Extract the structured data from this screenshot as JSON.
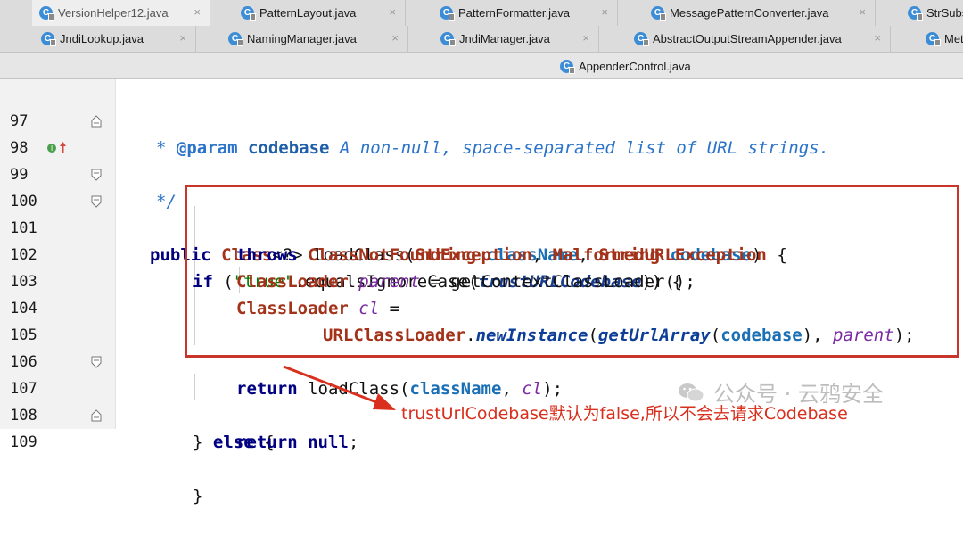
{
  "tabs": {
    "row1": [
      {
        "label": "VersionHelper12.java",
        "active": true
      },
      {
        "label": "PatternLayout.java"
      },
      {
        "label": "PatternFormatter.java"
      },
      {
        "label": "MessagePatternConverter.java"
      },
      {
        "label": "StrSubs"
      }
    ],
    "row2": [
      {
        "label": "JndiLookup.java"
      },
      {
        "label": "NamingManager.java"
      },
      {
        "label": "JndiManager.java"
      },
      {
        "label": "AbstractOutputStreamAppender.java"
      },
      {
        "label": "Met"
      }
    ],
    "row3": [
      {
        "label": "AppenderControl.java"
      }
    ],
    "close_glyph": "×",
    "class_icon_glyph": "C"
  },
  "editor": {
    "line_numbers": [
      "97",
      "98",
      "99",
      "100",
      "101",
      "102",
      "103",
      "104",
      "105",
      "106",
      "107",
      "108",
      "109"
    ],
    "code": {
      "l97": {
        "star": "* ",
        "tag": "@param",
        "sp1": " ",
        "name": "codebase",
        "rest": " A non-null, space-separated list of URL strings."
      },
      "l98": {
        "text": "*/"
      },
      "l99": {
        "kw_public": "public",
        "sp": " ",
        "type_class": "Class",
        "generic": "<?> loadClass(",
        "type_string1": "String",
        "sp2": " ",
        "p_classname": "className",
        "comma": ", ",
        "type_string2": "String",
        "sp3": " ",
        "p_codebase": "codebase",
        "close": ")"
      },
      "l100": {
        "kw_throws": "throws",
        "sp": " ",
        "ex1": "ClassNotFoundException",
        "comma": ", ",
        "ex2": "MalformedURLException",
        "brace": " {"
      },
      "l101": {
        "kw_if": "if",
        "open": " (",
        "str": "\"true\"",
        "mid": ".equalsIgnoreCase(",
        "field": "trustURLCodebase",
        "close": ")) {"
      },
      "l102": {
        "type": "ClassLoader",
        "sp": " ",
        "var": "parent",
        "rest": " = getContextClassLoader();"
      },
      "l103": {
        "type": "ClassLoader",
        "sp": " ",
        "var": "cl",
        "rest": " ="
      },
      "l104": {
        "type": "URLClassLoader",
        "dot": ".",
        "m1": "newInstance",
        "open": "(",
        "m2": "getUrlArray",
        "open2": "(",
        "arg": "codebase",
        "mid": "), ",
        "var": "parent",
        "end": ");"
      },
      "l105": {
        "text": ""
      },
      "l106": {
        "kw_return": "return",
        "mid": " loadClass(",
        "arg": "className",
        "comma": ", ",
        "var": "cl",
        "end": ");"
      },
      "l107": {
        "brace": "} ",
        "kw_else": "else",
        "open": " {"
      },
      "l108": {
        "kw_return": "return",
        "sp": " ",
        "kw_null": "null",
        "end": ";"
      },
      "l109": {
        "text": "}"
      }
    }
  },
  "annotation": {
    "text": "trustUrlCodebase默认为false,所以不会去请求Codebase",
    "color": "#d9301e"
  },
  "watermark": {
    "text": "公众号 · 云鸦安全"
  },
  "colors": {
    "highlight_box": "#c8362b",
    "keyword": "#000080",
    "type": "#a3321a",
    "parameter": "#1a6fb5",
    "string": "#008000"
  }
}
